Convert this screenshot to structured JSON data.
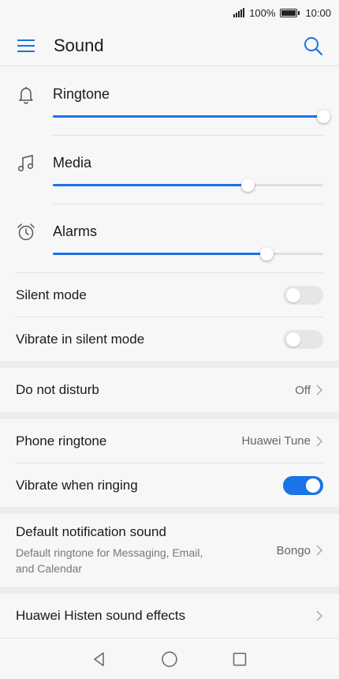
{
  "status": {
    "battery": "100%",
    "time": "10:00"
  },
  "header": {
    "title": "Sound"
  },
  "volume": [
    {
      "label": "Ringtone",
      "icon": "bell-icon",
      "level": 1.0
    },
    {
      "label": "Media",
      "icon": "music-note-icon",
      "level": 0.72
    },
    {
      "label": "Alarms",
      "icon": "alarm-clock-icon",
      "level": 0.79
    }
  ],
  "settings": {
    "silent_mode": {
      "label": "Silent mode",
      "on": false
    },
    "vibrate_silent": {
      "label": "Vibrate in silent mode",
      "on": false
    },
    "dnd": {
      "label": "Do not disturb",
      "value": "Off"
    },
    "phone_ringtone": {
      "label": "Phone ringtone",
      "value": "Huawei Tune"
    },
    "vibrate_ringing": {
      "label": "Vibrate when ringing",
      "on": true
    },
    "notification_sound": {
      "label": "Default notification sound",
      "sub": "Default ringtone for Messaging, Email, and Calendar",
      "value": "Bongo"
    },
    "histen": {
      "label": "Huawei Histen sound effects"
    }
  },
  "colors": {
    "accent": "#1a73e8",
    "background": "#f7f7f7"
  }
}
